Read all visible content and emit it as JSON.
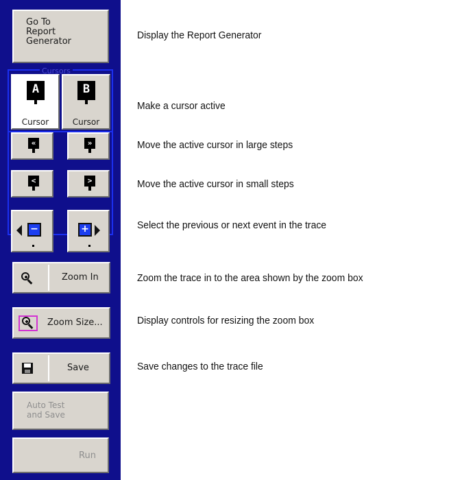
{
  "panel": {
    "go_to_report": {
      "lines": [
        "Go To",
        "Report",
        "Generator"
      ]
    },
    "cursors_group": {
      "title": "Cursors",
      "cursor_a": {
        "letter": "A",
        "label": "Cursor"
      },
      "cursor_b": {
        "letter": "B",
        "label": "Cursor"
      }
    },
    "large_step": {
      "left_glyph": "«",
      "right_glyph": "»"
    },
    "small_step": {
      "left_glyph": "<",
      "right_glyph": ">"
    },
    "event": {
      "prev_glyph": "−",
      "next_glyph": "+"
    },
    "zoom_in": {
      "label": "Zoom In",
      "icon": "magnifier-plus-icon"
    },
    "zoom_size": {
      "label": "Zoom Size...",
      "icon": "magnifier-box-icon"
    },
    "save": {
      "label": "Save",
      "icon": "floppy-disk-icon"
    },
    "auto_test": {
      "lines": [
        "Auto Test",
        "and  Save"
      ],
      "enabled": false
    },
    "run": {
      "label": "Run",
      "enabled": false
    }
  },
  "descriptions": {
    "report": "Display the Report Generator",
    "cursor_active": "Make a cursor active",
    "large_steps": "Move the active cursor in large steps",
    "small_steps": "Move the active cursor in small steps",
    "event": "Select the previous or next event in the trace",
    "zoom_in": "Zoom the trace in to the area shown by the zoom box",
    "zoom_size": "Display controls for resizing the zoom box",
    "save": "Save changes to the trace file"
  },
  "colors": {
    "panel_bg": "#0f0f8c",
    "group_border": "#1b2ff0",
    "button_face": "#d9d5ce",
    "event_box": "#1c3ef0",
    "zoom_box_outline": "#d233d2"
  }
}
